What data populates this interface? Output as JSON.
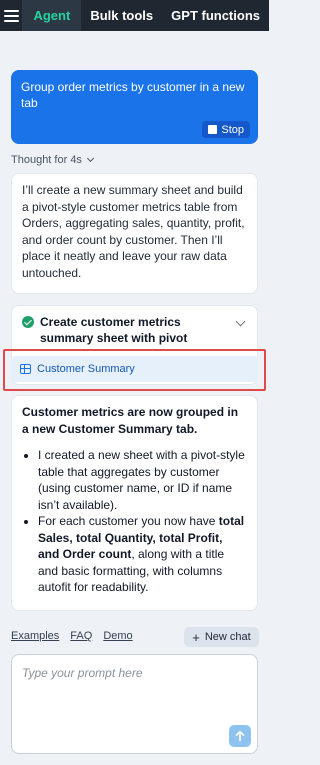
{
  "nav": {
    "tabs": [
      {
        "label": "Agent",
        "active": true
      },
      {
        "label": "Bulk tools"
      },
      {
        "label": "GPT functions"
      }
    ]
  },
  "user_message": {
    "text": "Group order metrics by customer in a new tab",
    "stop_label": "Stop"
  },
  "thought": {
    "label": "Thought for 4s"
  },
  "assistant_intro": "I’ll create a new summary sheet and build a pivot-style customer metrics table from Orders, aggregating sales, quantity, profit, and order count by customer. Then I’ll place it neatly and leave your raw data untouched.",
  "task": {
    "title": "Create customer metrics summary sheet with pivot",
    "status": "complete",
    "link_label": "Customer Summary"
  },
  "assistant_result": {
    "lead": "Customer metrics are now grouped in a new Customer Summary tab.",
    "bullet1": "I created a new sheet with a pivot-style table that aggregates by customer (using customer name, or ID if name isn’t available).",
    "bullet2_pre": "For each customer you now have ",
    "bullet2_bold": "total Sales, total Quantity, total Profit, and Order count",
    "bullet2_post": ", along with a title and basic formatting, with columns autofit for readability."
  },
  "footer": {
    "links": [
      "Examples",
      "FAQ",
      "Demo"
    ],
    "new_chat_label": "New chat"
  },
  "composer": {
    "placeholder": "Type your prompt here"
  },
  "colors": {
    "accent": "#1a73e8",
    "active_tab": "#27d3a0",
    "topbar": "#1f2730",
    "success": "#1f9e6a",
    "highlight": "#e14a4a"
  }
}
